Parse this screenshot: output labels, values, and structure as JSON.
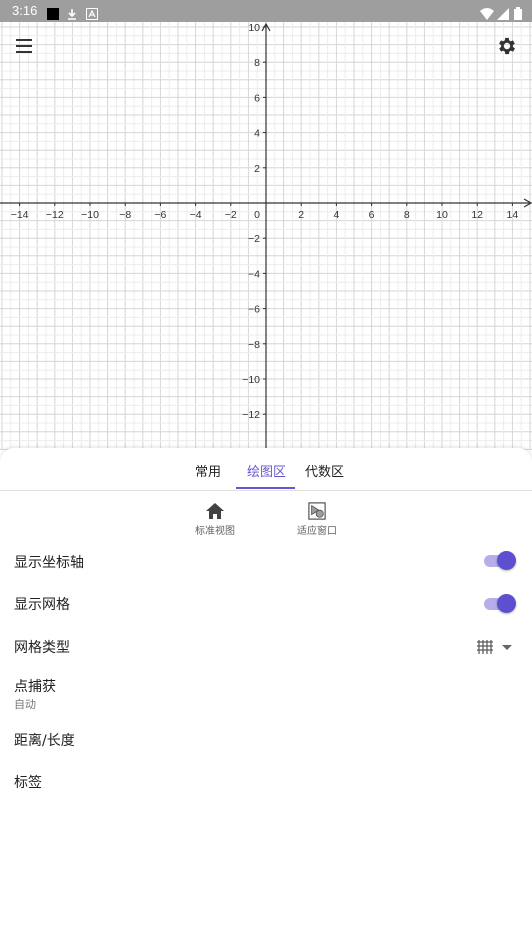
{
  "status_bar": {
    "time": "3:16"
  },
  "graph": {
    "x_ticks": [
      "−14",
      "−12",
      "−10",
      "−8",
      "−6",
      "−4",
      "−2",
      "2",
      "4",
      "6",
      "8",
      "10",
      "12",
      "14"
    ],
    "y_ticks_pos": [
      "10",
      "8",
      "6",
      "4",
      "2"
    ],
    "y_ticks_neg": [
      "−2",
      "−4",
      "−6",
      "−8",
      "−10",
      "−12"
    ],
    "origin": "0",
    "x_range": [
      -15,
      15
    ],
    "y_range": [
      -13.4,
      10.8
    ]
  },
  "tabs": [
    {
      "label": "常用"
    },
    {
      "label": "绘图区"
    },
    {
      "label": "代数区"
    }
  ],
  "quick_buttons": {
    "standard_view": "标准视图",
    "fit_window": "适应窗口"
  },
  "settings": {
    "show_axes": {
      "label": "显示坐标轴",
      "on": true
    },
    "show_grid": {
      "label": "显示网格",
      "on": true
    },
    "grid_type": {
      "label": "网格类型"
    },
    "point_capture": {
      "label": "点捕获",
      "value": "自动"
    },
    "distance": {
      "label": "距离/长度"
    },
    "labels": {
      "label": "标签"
    }
  },
  "colors": {
    "accent": "#6557d2",
    "status_bar": "#9e9e9e"
  }
}
